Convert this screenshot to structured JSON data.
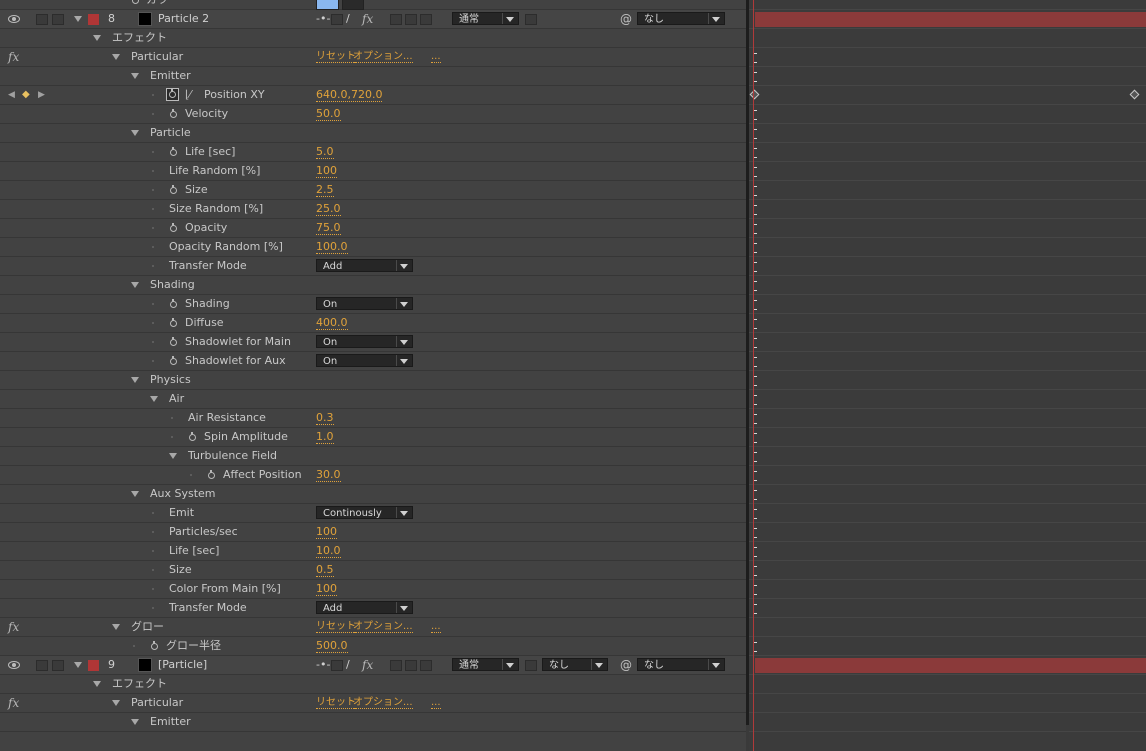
{
  "colors": {
    "label_red": "#b03636",
    "value_orange": "#e0a23a",
    "timeline_bar": "#8b3a3a",
    "swatch_blue": "#8ab8f0"
  },
  "top_partial": {
    "label": "カラー"
  },
  "layer8": {
    "num": "8",
    "name": "Particle 2",
    "mode": "通常",
    "trkmat": "なし"
  },
  "layer9": {
    "num": "9",
    "name": "[Particle]",
    "mode": "通常",
    "trkmat": "なし",
    "parent": "なし"
  },
  "effects_label": "エフェクト",
  "fx_glyph": "fx",
  "reset": "リセット",
  "options": "オプション...",
  "ellipsis": "...",
  "particular": {
    "name": "Particular",
    "emitter": {
      "label": "Emitter",
      "position_xy": {
        "label": "Position XY",
        "value": "640.0,720.0"
      },
      "velocity": {
        "label": "Velocity",
        "value": "50.0"
      }
    },
    "particle": {
      "label": "Particle",
      "life": {
        "label": "Life [sec]",
        "value": "5.0"
      },
      "life_random": {
        "label": "Life Random [%]",
        "value": "100"
      },
      "size": {
        "label": "Size",
        "value": "2.5"
      },
      "size_random": {
        "label": "Size Random [%]",
        "value": "25.0"
      },
      "opacity": {
        "label": "Opacity",
        "value": "75.0"
      },
      "opacity_random": {
        "label": "Opacity Random [%]",
        "value": "100.0"
      },
      "transfer_mode": {
        "label": "Transfer Mode",
        "value": "Add"
      }
    },
    "shading": {
      "label": "Shading",
      "shading": {
        "label": "Shading",
        "value": "On"
      },
      "diffuse": {
        "label": "Diffuse",
        "value": "400.0"
      },
      "shadowlet_main": {
        "label": "Shadowlet for Main",
        "value": "On"
      },
      "shadowlet_aux": {
        "label": "Shadowlet for Aux",
        "value": "On"
      }
    },
    "physics": {
      "label": "Physics",
      "air": {
        "label": "Air",
        "air_resistance": {
          "label": "Air Resistance",
          "value": "0.3"
        },
        "spin_amplitude": {
          "label": "Spin Amplitude",
          "value": "1.0"
        },
        "turbulence": {
          "label": "Turbulence Field",
          "affect_position": {
            "label": "Affect Position",
            "value": "30.0"
          }
        }
      }
    },
    "aux_system": {
      "label": "Aux System",
      "emit": {
        "label": "Emit",
        "value": "Continously"
      },
      "particles_sec": {
        "label": "Particles/sec",
        "value": "100"
      },
      "life": {
        "label": "Life [sec]",
        "value": "10.0"
      },
      "size": {
        "label": "Size",
        "value": "0.5"
      },
      "color_from_main": {
        "label": "Color From Main [%]",
        "value": "100"
      },
      "transfer_mode": {
        "label": "Transfer Mode",
        "value": "Add"
      }
    }
  },
  "glow": {
    "name": "グロー",
    "radius": {
      "label": "グロー半径",
      "value": "500.0"
    }
  },
  "layer9_effects": {
    "particular_name": "Particular",
    "emitter_label": "Emitter"
  }
}
